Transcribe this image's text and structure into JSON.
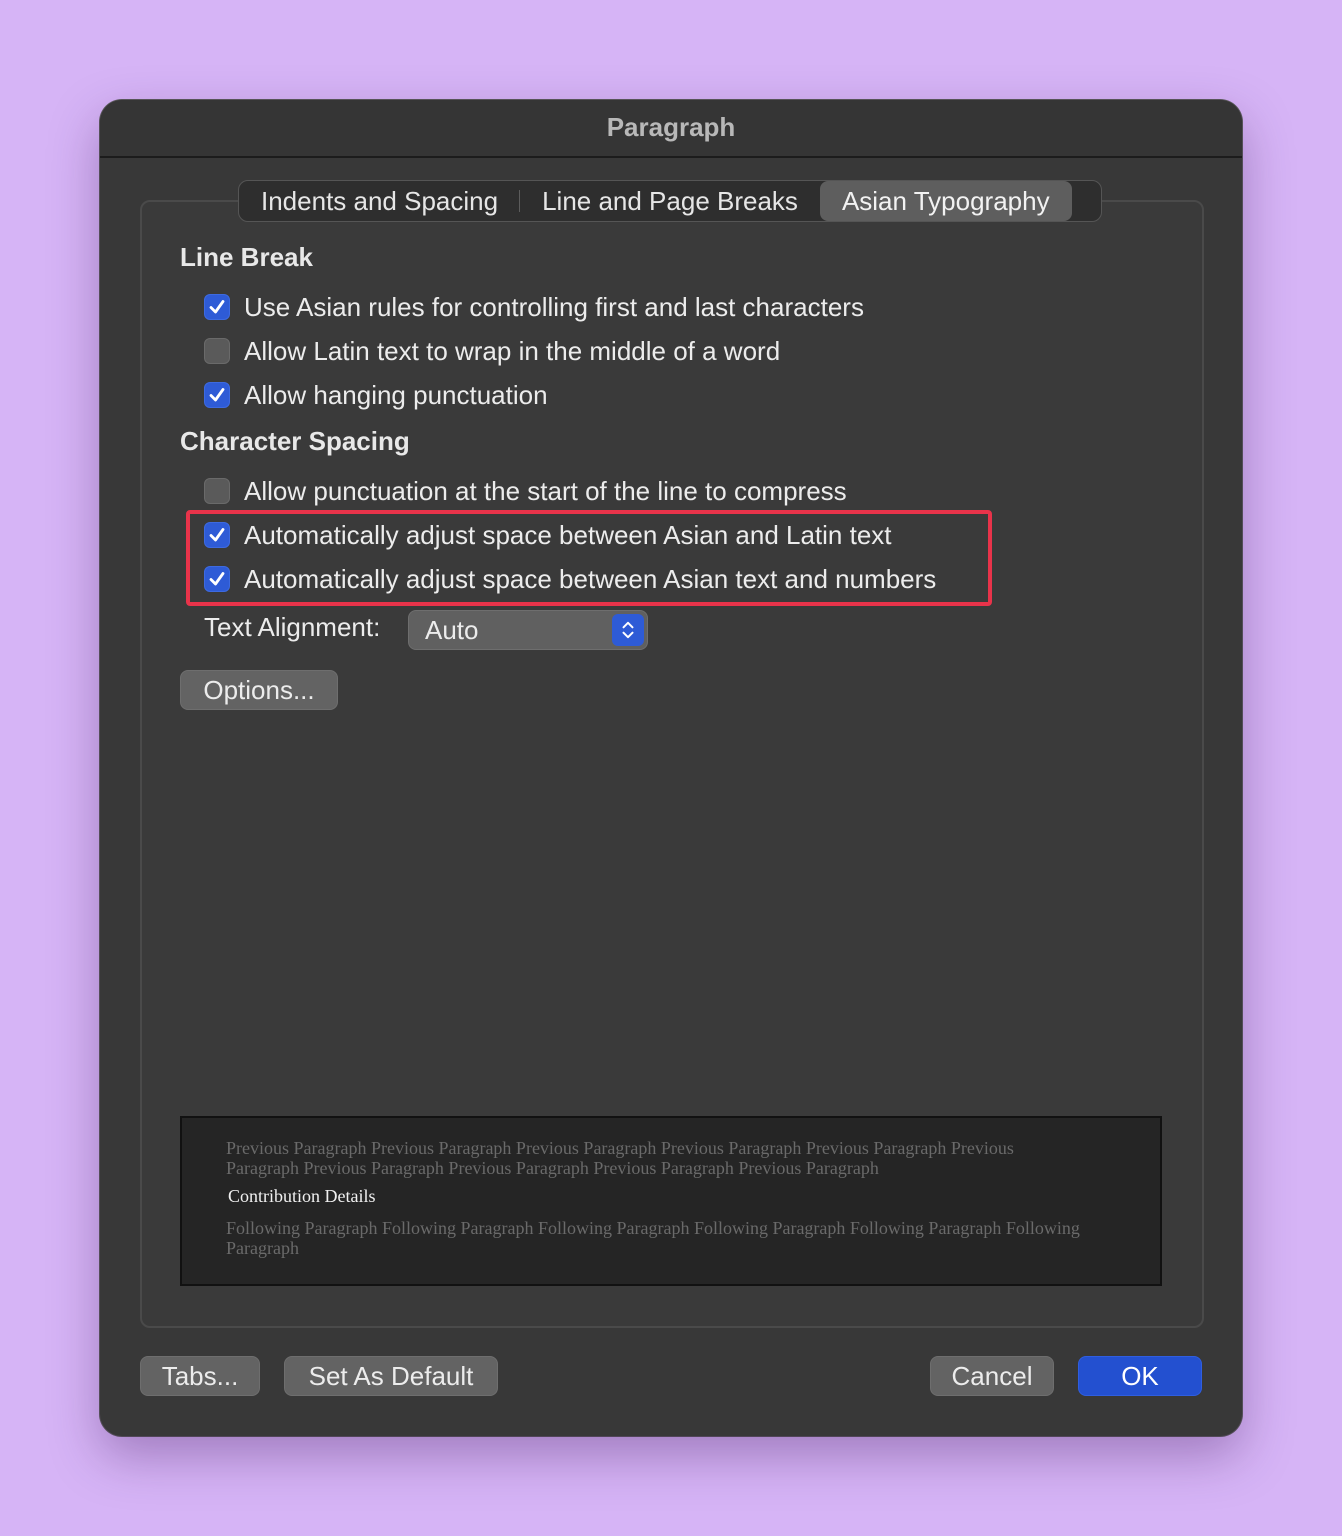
{
  "dialog": {
    "title": "Paragraph"
  },
  "tabs": [
    {
      "label": "Indents and Spacing",
      "active": false
    },
    {
      "label": "Line and Page Breaks",
      "active": false
    },
    {
      "label": "Asian Typography",
      "active": true
    }
  ],
  "line_break": {
    "heading": "Line Break",
    "options": [
      {
        "label": "Use Asian rules for controlling first and last characters",
        "checked": true
      },
      {
        "label": "Allow Latin text to wrap in the middle of a word",
        "checked": false
      },
      {
        "label": "Allow hanging punctuation",
        "checked": true
      }
    ]
  },
  "character_spacing": {
    "heading": "Character Spacing",
    "options": [
      {
        "label": "Allow punctuation at the start of the line to compress",
        "checked": false
      },
      {
        "label": "Automatically adjust space between Asian and Latin text",
        "checked": true
      },
      {
        "label": "Automatically adjust space between Asian text and numbers",
        "checked": true
      }
    ]
  },
  "text_alignment": {
    "label": "Text Alignment:",
    "value": "Auto"
  },
  "options_button": "Options...",
  "preview": {
    "previous": "Previous Paragraph Previous Paragraph Previous Paragraph Previous Paragraph Previous Paragraph Previous Paragraph Previous Paragraph Previous Paragraph Previous Paragraph Previous Paragraph",
    "current": "Contribution Details",
    "following": "Following Paragraph Following Paragraph Following Paragraph Following Paragraph Following Paragraph Following Paragraph"
  },
  "footer": {
    "tabs_button": "Tabs...",
    "set_default_button": "Set As Default",
    "cancel_button": "Cancel",
    "ok_button": "OK"
  },
  "colors": {
    "background": "#d6b4f6",
    "dialog": "#383838",
    "accent": "#2e5bd6",
    "highlight_border": "#e8334a"
  }
}
